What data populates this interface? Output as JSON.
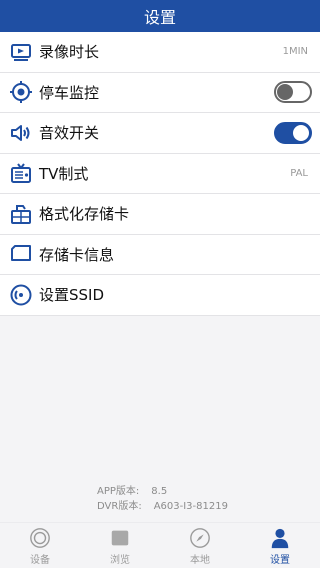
{
  "header": {
    "title": "设置"
  },
  "settings": [
    {
      "icon": "video-duration-icon",
      "label": "录像时长",
      "value": "1MIN"
    },
    {
      "icon": "parking-monitor-icon",
      "label": "停车监控",
      "toggle": "off"
    },
    {
      "icon": "sound-icon",
      "label": "音效开关",
      "toggle": "on"
    },
    {
      "icon": "tv-format-icon",
      "label": "TV制式",
      "value": "PAL"
    },
    {
      "icon": "format-sdcard-icon",
      "label": "格式化存储卡"
    },
    {
      "icon": "sdcard-info-icon",
      "label": "存储卡信息"
    },
    {
      "icon": "wifi-ssid-icon",
      "label": "设置SSID"
    }
  ],
  "version": {
    "app_label": "APP版本:",
    "app_value": "8.5",
    "dvr_label": "DVR版本:",
    "dvr_value": "A603-I3-81219"
  },
  "tabs": [
    {
      "icon": "device-icon",
      "label": "设备",
      "active": false
    },
    {
      "icon": "browse-icon",
      "label": "浏览",
      "active": false
    },
    {
      "icon": "local-compass-icon",
      "label": "本地",
      "active": false
    },
    {
      "icon": "settings-user-icon",
      "label": "设置",
      "active": true
    }
  ],
  "colors": {
    "primary": "#1f4fa3",
    "background": "#f4f4f6",
    "divider": "#e3e3e6"
  }
}
